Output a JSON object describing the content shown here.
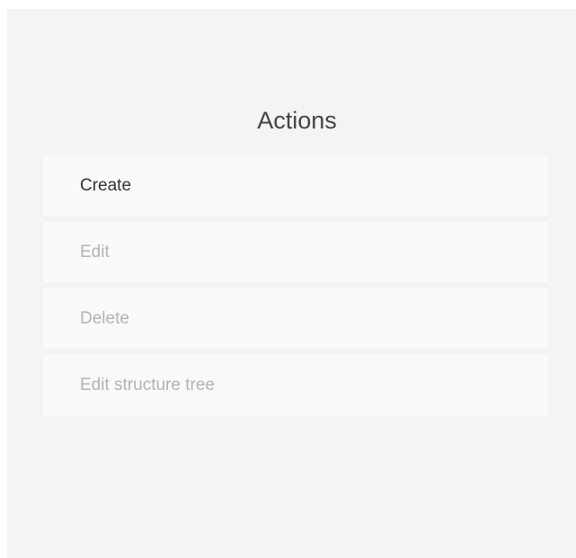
{
  "panel": {
    "title": "Actions",
    "actions": [
      {
        "label": "Create",
        "enabled": true
      },
      {
        "label": "Edit",
        "enabled": false
      },
      {
        "label": "Delete",
        "enabled": false
      },
      {
        "label": "Edit structure tree",
        "enabled": false
      }
    ]
  },
  "colors": {
    "panel_background": "#f4f4f4",
    "item_background": "#fafafa",
    "enabled_text": "#333333",
    "disabled_text": "#b3b3b3"
  }
}
